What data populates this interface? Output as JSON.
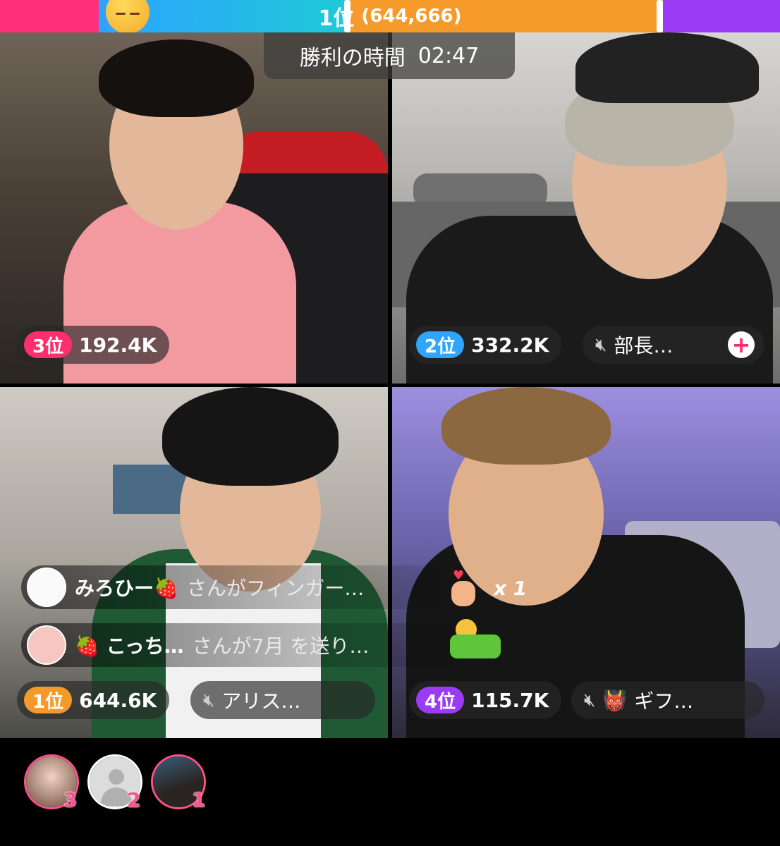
{
  "top_bar": {
    "rank_label": "1位",
    "score_label": "(644,666)",
    "colors": {
      "pink": "#ff2f7a",
      "blue": "#2ca3ff",
      "orange": "#f59a2b",
      "purple": "#9b3bf5"
    },
    "emoji_icon": "sleepy-face-icon"
  },
  "timer": {
    "label": "勝利の時間",
    "time": "02:47"
  },
  "tiles": {
    "top_left": {
      "rank": "3位",
      "score": "192.4K",
      "rank_color": "#ff2f6d"
    },
    "top_right": {
      "rank": "2位",
      "score": "332.2K",
      "rank_color": "#2ea5ff",
      "name": "部長…",
      "plus_label": "+"
    },
    "bottom_left": {
      "rank": "1位",
      "score": "644.6K",
      "rank_color": "#f39a2b",
      "name": "アリス…"
    },
    "bottom_right": {
      "rank": "4位",
      "score": "115.7K",
      "rank_color": "#9b3bf5",
      "name": "ギフ…",
      "name_emoji": "👹"
    }
  },
  "gifts": [
    {
      "user": "みろひー🍓",
      "text": "さんがフィンガー…",
      "multiplier": "x 1",
      "gift_icon": "finger-heart-icon"
    },
    {
      "user": "🍓 こっち…",
      "text": "さんが7月 を送り…",
      "gift_icon": "july-sticker-icon"
    }
  ],
  "bottom_ranking": [
    {
      "rank": "3"
    },
    {
      "rank": "2"
    },
    {
      "rank": "1"
    }
  ]
}
